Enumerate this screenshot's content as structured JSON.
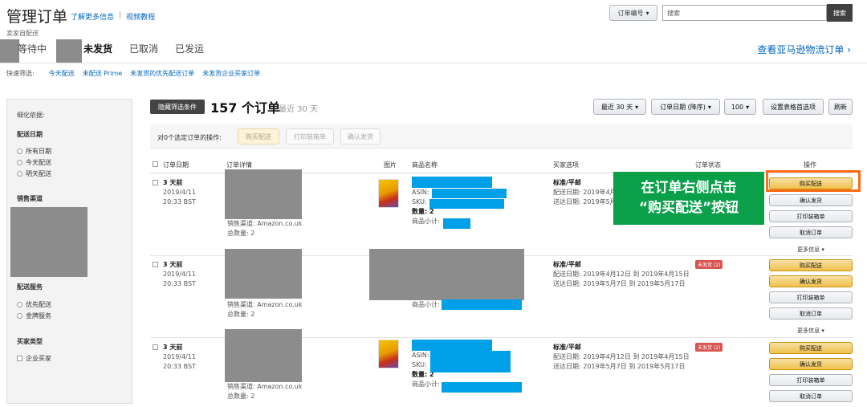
{
  "header": {
    "title": "管理订单",
    "learn_more": "了解更多信息",
    "separator": "|",
    "video_tutorial": "视频教程",
    "seller_fulfilled": "卖家自配送",
    "search_select": "订单编号",
    "search_placeholder": "搜索",
    "search_button": "搜索"
  },
  "tabs": {
    "pending": "等待中",
    "unshipped": "未发货",
    "cancelled": "已取消",
    "shipped": "已发运",
    "fba_link": "查看亚马逊物流订单 ›"
  },
  "quick_filter": {
    "label": "快速筛选:",
    "items": [
      "今天配送",
      "未配送 Prime",
      "未发货的优先配送订单",
      "未发货企业买家订单"
    ]
  },
  "filters": {
    "refine_by": "细化依据:",
    "delivery_date": "配送日期",
    "date_options": [
      "所有日期",
      "今天配送",
      "明天配送"
    ],
    "sales_channel": "销售渠道",
    "shipping_service": "配送服务",
    "service_options": [
      "优先配送",
      "金牌服务"
    ],
    "buyer_type": "买家类型",
    "buyer_options": [
      "企业买家"
    ]
  },
  "results": {
    "hide_filters": "隐藏筛选条件",
    "count": "157 个订单",
    "range": "最近 30 天",
    "period_select": "最近 30 天",
    "sort_select": "订单日期 (降序)",
    "page_size": "100",
    "table_settings": "设置表格首选项",
    "refresh": "刷新",
    "selected_actions": "对0个选定订单的操作:",
    "buy_shipping": "购买配送",
    "print_slip": "打印装箱单",
    "confirm_ship": "确认发货"
  },
  "columns": {
    "order_date": "订单日期",
    "order_details": "订单详情",
    "image": "图片",
    "product_name": "商品名称",
    "shipping_option": "买家选项",
    "order_status": "订单状态",
    "actions": "操作"
  },
  "rows": [
    {
      "age": "3 天前",
      "date": "2019/4/11",
      "time": "20:33 BST",
      "channel": "销售渠道: Amazon.co.uk",
      "total": "总数量: 2",
      "asin": "ASIN:",
      "sku": "SKU:",
      "qty": "数量: 2",
      "subtotal": "商品小计:",
      "ship_type": "标准/平邮",
      "ship_date": "配送日期: 2019年4月",
      "deliver_date": "送达日期: 2019年5月",
      "status": ""
    },
    {
      "age": "3 天前",
      "date": "2019/4/11",
      "time": "20:33 BST",
      "channel": "销售渠道: Amazon.co.uk",
      "total": "总数量: 2",
      "subtotal": "商品小计:",
      "ship_type": "标准/平邮",
      "ship_date": "配送日期: 2019年4月12日 到 2019年4月15日",
      "deliver_date": "送达日期: 2019年5月7日 到 2019年5月17日",
      "status": "未发货 (2)"
    },
    {
      "age": "3 天前",
      "date": "2019/4/11",
      "time": "20:33 BST",
      "channel": "销售渠道: Amazon.co.uk",
      "total": "总数量: 2",
      "asin": "ASIN:",
      "sku": "SKU:",
      "qty": "数量: 2",
      "subtotal": "商品小计:",
      "ship_type": "标准/平邮",
      "ship_date": "配送日期: 2019年4月12日 到 2019年4月15日",
      "deliver_date": "送达日期: 2019年5月7日 到 2019年5月17日",
      "status": "未发货 (2)"
    }
  ],
  "row_actions": {
    "buy_shipping": "购买配送",
    "confirm_ship": "确认发货",
    "print_slip": "打印装箱单",
    "cancel_order": "取消订单",
    "more_info": "更多信息 ▾"
  },
  "callout": {
    "line1": "在订单右侧点击",
    "line2": "“购买配送”按钮"
  },
  "colors": {
    "link": "#0066c0",
    "callout_bg": "#0aa04a",
    "highlight": "#ff6a13",
    "primary_button": "#f0c14b",
    "redaction_gray": "#8c8c8c",
    "redaction_blue": "#00a0e9",
    "status_red": "#d9534f"
  }
}
